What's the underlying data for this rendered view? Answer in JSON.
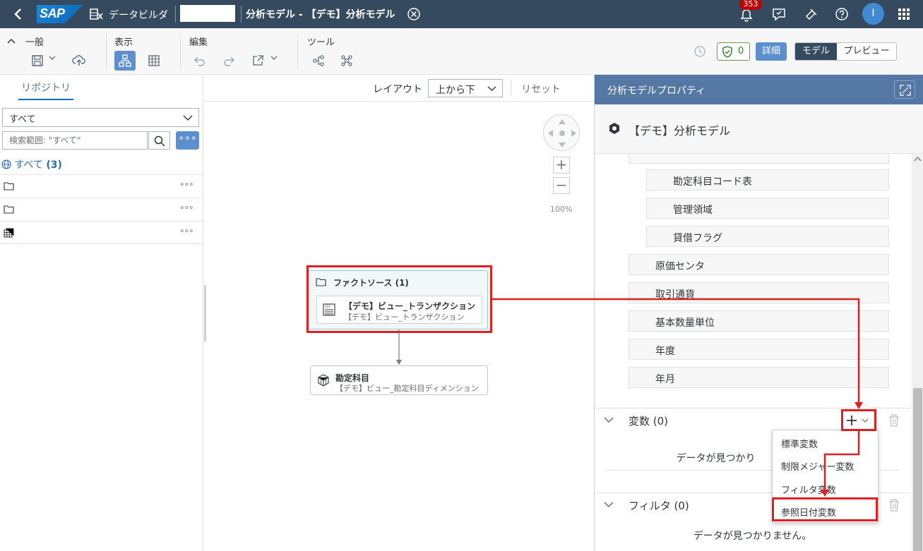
{
  "shell": {
    "logo": "SAP",
    "app_name": "データビルダ",
    "document_title": "分析モデル - 【デモ】分析モデル",
    "notification_count": "353",
    "avatar_initial": "I"
  },
  "toolbar": {
    "general_label": "一般",
    "view_label": "表示",
    "edit_label": "編集",
    "tools_label": "ツール",
    "validation_count": "0",
    "details_label": "詳細",
    "mode_model": "モデル",
    "mode_preview": "プレビュー"
  },
  "repository": {
    "tab_label": "リポジトリ",
    "filter_value": "すべて",
    "search_placeholder": "検索範囲: \"すべて\"",
    "all_label": "すべて",
    "all_count": "(3)"
  },
  "canvas": {
    "layout_label": "レイアウト",
    "layout_value": "上から下",
    "reset_label": "リセット",
    "zoom_level": "100%",
    "fact_source": {
      "header": "ファクトソース (1)",
      "item_title": "【デモ】ビュー_トランザクション",
      "item_subtitle": "【デモ】ビュー_トランザクション"
    },
    "dimension": {
      "title": "勘定科目",
      "subtitle": "【デモ】ビュー_勘定科目ディメンション"
    }
  },
  "properties": {
    "header": "分析モデルプロパティ",
    "model_name": "【デモ】分析モデル",
    "attributes_level2": [
      "勘定科目コード表",
      "管理領域",
      "貸借フラグ"
    ],
    "attributes_level1": [
      "原価センタ",
      "取引通貨",
      "基本数量単位",
      "年度",
      "年月"
    ],
    "variables_label": "変数 (0)",
    "filters_label": "フィルタ (0)",
    "no_data": "データが見つかりません。",
    "variables_no_data": "データが見つかり",
    "variable_menu": [
      "標準変数",
      "制限メジャー変数",
      "フィルタ変数",
      "参照日付変数"
    ]
  },
  "colors": {
    "shell_bg": "#354a5f",
    "accent": "#5b8fce",
    "highlight": "#e02020"
  }
}
